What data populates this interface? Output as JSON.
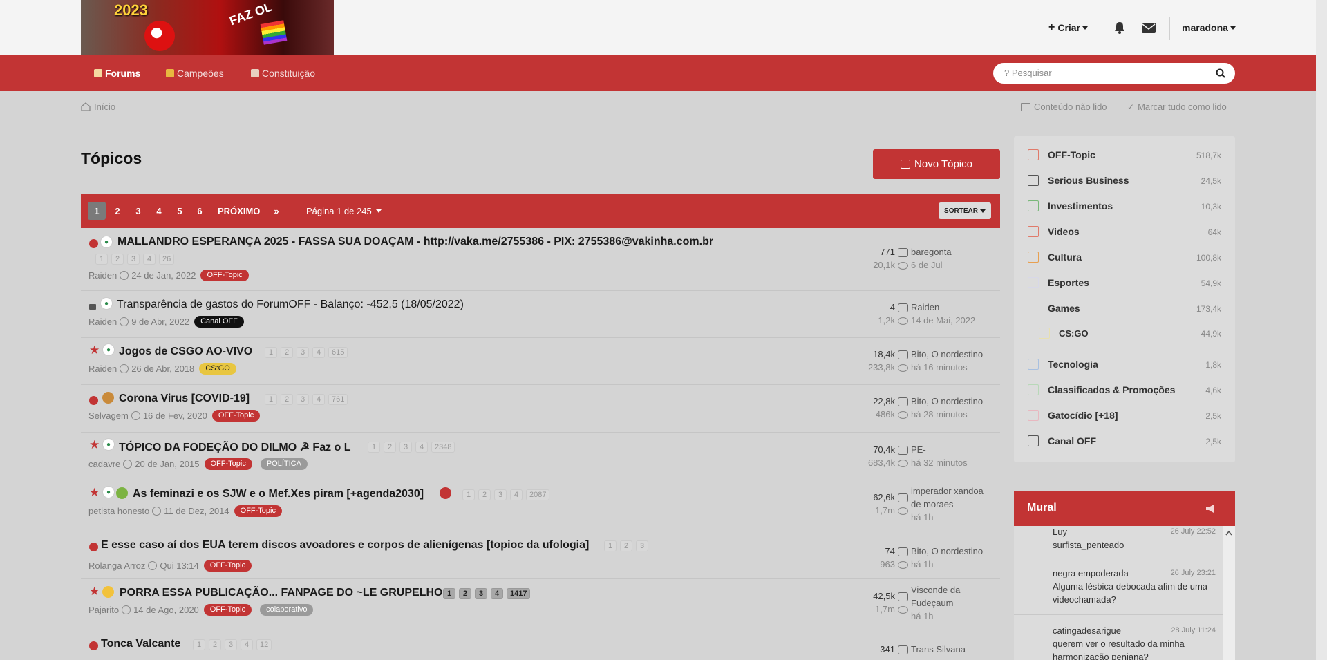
{
  "header": {
    "banner": {
      "year": "2023",
      "faz": "FAZ OL"
    },
    "criar": "Criar",
    "username": "maradona"
  },
  "nav": {
    "items": [
      "Forums",
      "Campeões",
      "Constituição"
    ],
    "search_placeholder": "? Pesquisar"
  },
  "breadcrumb": {
    "home": "Início"
  },
  "actions": {
    "unread": "Conteúdo não lido",
    "mark_read": "Marcar tudo como lido"
  },
  "page": {
    "title": "Tópicos",
    "new_topic": "Novo Tópico"
  },
  "pagination": {
    "pages": [
      "1",
      "2",
      "3",
      "4",
      "5",
      "6"
    ],
    "next": "PRÓXIMO",
    "page_of": "Página 1 de 245",
    "sort": "SORTEAR"
  },
  "topics": [
    {
      "title": "MALLANDRO ESPERANÇA 2025 - FASSA SUA DOAÇAM - http://vaka.me/2755386 - PIX: 2755386@vakinha.com.br",
      "pages": [
        "1",
        "2",
        "3",
        "4",
        "26"
      ],
      "author": "Raiden",
      "date": "24 de Jan, 2022",
      "tags": [
        "OFF-Topic"
      ],
      "replies": "771",
      "views": "20,1k",
      "last_user": "baregonta",
      "last_date": "6 de Jul"
    },
    {
      "title": "Transparência de gastos do ForumOFF - Balanço: -452,5 (18/05/2022)",
      "pages": [],
      "author": "Raiden",
      "date": "9 de Abr, 2022",
      "tags": [
        "Canal OFF"
      ],
      "replies": "4",
      "views": "1,2k",
      "last_user": "Raiden",
      "last_date": "14 de Mai, 2022"
    },
    {
      "title": "Jogos de CSGO AO-VIVO",
      "pages": [
        "1",
        "2",
        "3",
        "4",
        "615"
      ],
      "author": "Raiden",
      "date": "26 de Abr, 2018",
      "tags": [
        "CS:GO"
      ],
      "replies": "18,4k",
      "views": "233,8k",
      "last_user": "Bito, O nordestino",
      "last_date": "há 16 minutos"
    },
    {
      "title": "Corona Virus [COVID-19]",
      "pages": [
        "1",
        "2",
        "3",
        "4",
        "761"
      ],
      "author": "Selvagem",
      "date": "16 de Fev, 2020",
      "tags": [
        "OFF-Topic"
      ],
      "replies": "22,8k",
      "views": "486k",
      "last_user": "Bito, O nordestino",
      "last_date": "há 28 minutos"
    },
    {
      "title": "TÓPICO DA FODEÇÃO DO DILMO ☭ Faz o L",
      "pages": [
        "1",
        "2",
        "3",
        "4",
        "2348"
      ],
      "author": "cadavre",
      "date": "20 de Jan, 2015",
      "tags": [
        "OFF-Topic",
        "POLÍTICA"
      ],
      "replies": "70,4k",
      "views": "683,4k",
      "last_user": "PE-",
      "last_date": "há 32 minutos"
    },
    {
      "title": "As feminazi e os SJW e o Mef.Xes piram [+agenda2030]",
      "pages": [
        "1",
        "2",
        "3",
        "4",
        "2087"
      ],
      "author": "petista honesto",
      "date": "11 de Dez, 2014",
      "tags": [
        "OFF-Topic"
      ],
      "replies": "62,6k",
      "views": "1,7m",
      "last_user": "imperador xandoa de moraes",
      "last_date": "há 1h"
    },
    {
      "title": "E esse caso aí dos EUA terem discos avoadores e corpos de alienígenas [topioc da ufologia]",
      "pages": [
        "1",
        "2",
        "3"
      ],
      "author": "Rolanga Arroz",
      "date": "Qui 13:14",
      "tags": [
        "OFF-Topic"
      ],
      "replies": "74",
      "views": "963",
      "last_user": "Bito, O nordestino",
      "last_date": "há 1h"
    },
    {
      "title": "PORRA ESSA PUBLICAÇÃO... FANPAGE DO ~LE GRUPELHO",
      "pages": [
        "1",
        "2",
        "3",
        "4",
        "1417"
      ],
      "author": "Pajarito",
      "date": "14 de Ago, 2020",
      "tags": [
        "OFF-Topic",
        "colaborativo"
      ],
      "replies": "42,5k",
      "views": "1,7m",
      "last_user": "Visconde da Fudeçaum",
      "last_date": "há 1h"
    },
    {
      "title": "Tonca Valcante",
      "pages": [
        "1",
        "2",
        "3",
        "4",
        "12"
      ],
      "author": "",
      "date": "",
      "tags": [],
      "replies": "341",
      "views": "",
      "last_user": "Trans Silvana",
      "last_date": ""
    }
  ],
  "categories": [
    {
      "name": "OFF-Topic",
      "count": "518,7k",
      "color": "#e07a6a"
    },
    {
      "name": "Serious Business",
      "count": "24,5k",
      "color": "#555555"
    },
    {
      "name": "Investimentos",
      "count": "10,3k",
      "color": "#7ab87a"
    },
    {
      "name": "Videos",
      "count": "64k",
      "color": "#e07a6a"
    },
    {
      "name": "Cultura",
      "count": "100,8k",
      "color": "#e8a050"
    },
    {
      "name": "Esportes",
      "count": "54,9k",
      "color": "#d8d8e8"
    },
    {
      "name": "Games",
      "count": "173,4k",
      "color": "#dcdcdc"
    },
    {
      "name": "CS:GO",
      "count": "44,9k",
      "color": "#e8e0b0"
    },
    {
      "name": "Tecnologia",
      "count": "1,8k",
      "color": "#a8c0e0"
    },
    {
      "name": "Classificados & Promoções",
      "count": "4,6k",
      "color": "#b8d8b8"
    },
    {
      "name": "Gatocídio [+18]",
      "count": "2,5k",
      "color": "#e8b8c0"
    },
    {
      "name": "Canal OFF",
      "count": "2,5k",
      "color": "#555555"
    }
  ],
  "mural": {
    "title": "Mural",
    "posts": [
      {
        "user": "Luy",
        "time": "26 July 22:52",
        "text": "surfista_penteado"
      },
      {
        "user": "negra empoderada",
        "time": "26 July 23:21",
        "text": "Alguma lésbica debocada afim de uma videochamada?"
      },
      {
        "user": "catingadesarigue",
        "time": "28 July 11:24",
        "text": "querem ver o resultado da minha harmonização peniana?"
      }
    ]
  }
}
